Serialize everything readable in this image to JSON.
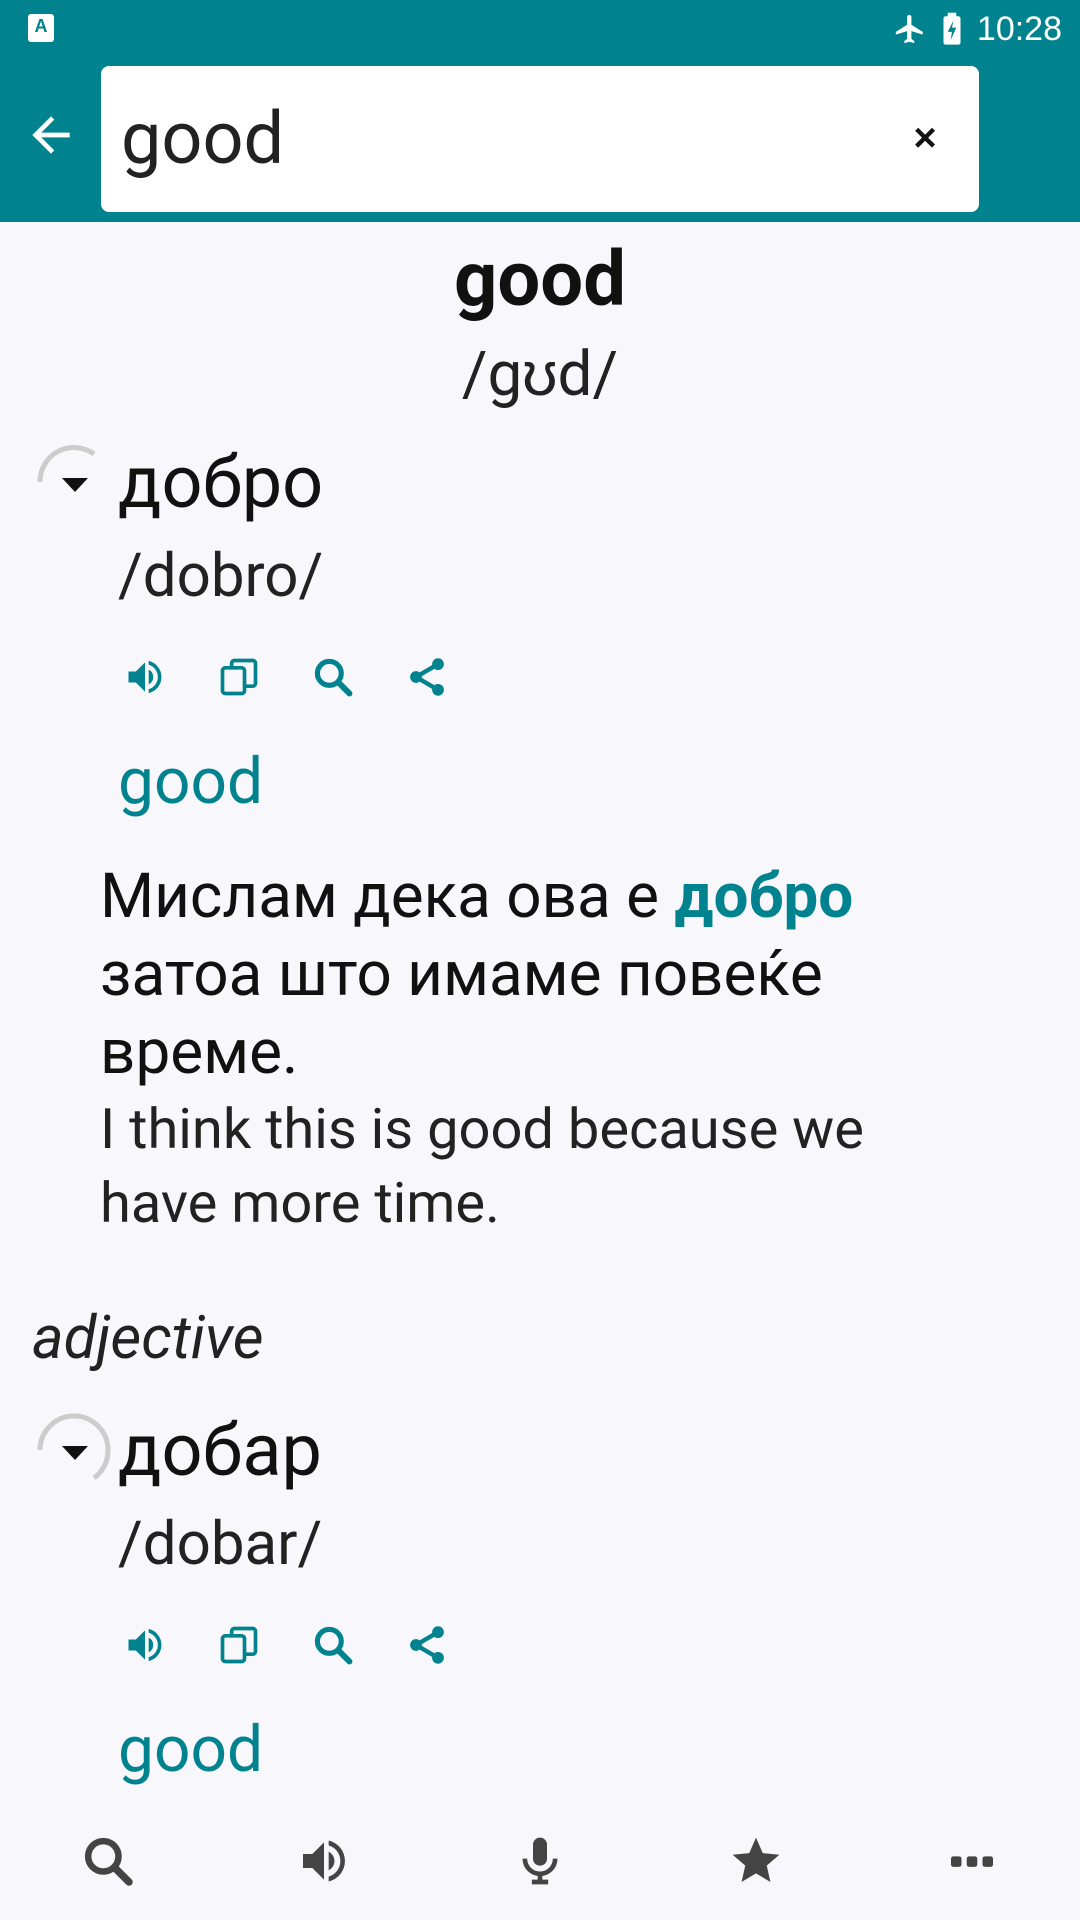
{
  "colors": {
    "accent": "#00838f",
    "background": "#f8f7fc",
    "text": "#111111"
  },
  "status_bar": {
    "time": "10:28",
    "left_icon_letter": "A"
  },
  "search": {
    "query": "good",
    "clear_label": "×"
  },
  "headword": {
    "word": "good",
    "phonetic": "/gʊd/"
  },
  "entries": [
    {
      "word": "добро",
      "phonetic": "/dobro/",
      "translation": "good",
      "example_mk_before": "Мислам дека ова е ",
      "example_mk_highlight": "добро",
      "example_mk_after": " затоа што имаме повеќе време.",
      "example_en": "I think this is good because we have more time."
    },
    {
      "part_of_speech": "adjective",
      "word": "добар",
      "phonetic": "/dobar/",
      "translation": "good"
    }
  ],
  "icons": {
    "actions": [
      "speaker-icon",
      "copy-icon",
      "search-icon",
      "share-icon"
    ],
    "bottom_nav": [
      "search-icon",
      "speaker-icon",
      "microphone-icon",
      "star-icon",
      "more-icon"
    ]
  }
}
